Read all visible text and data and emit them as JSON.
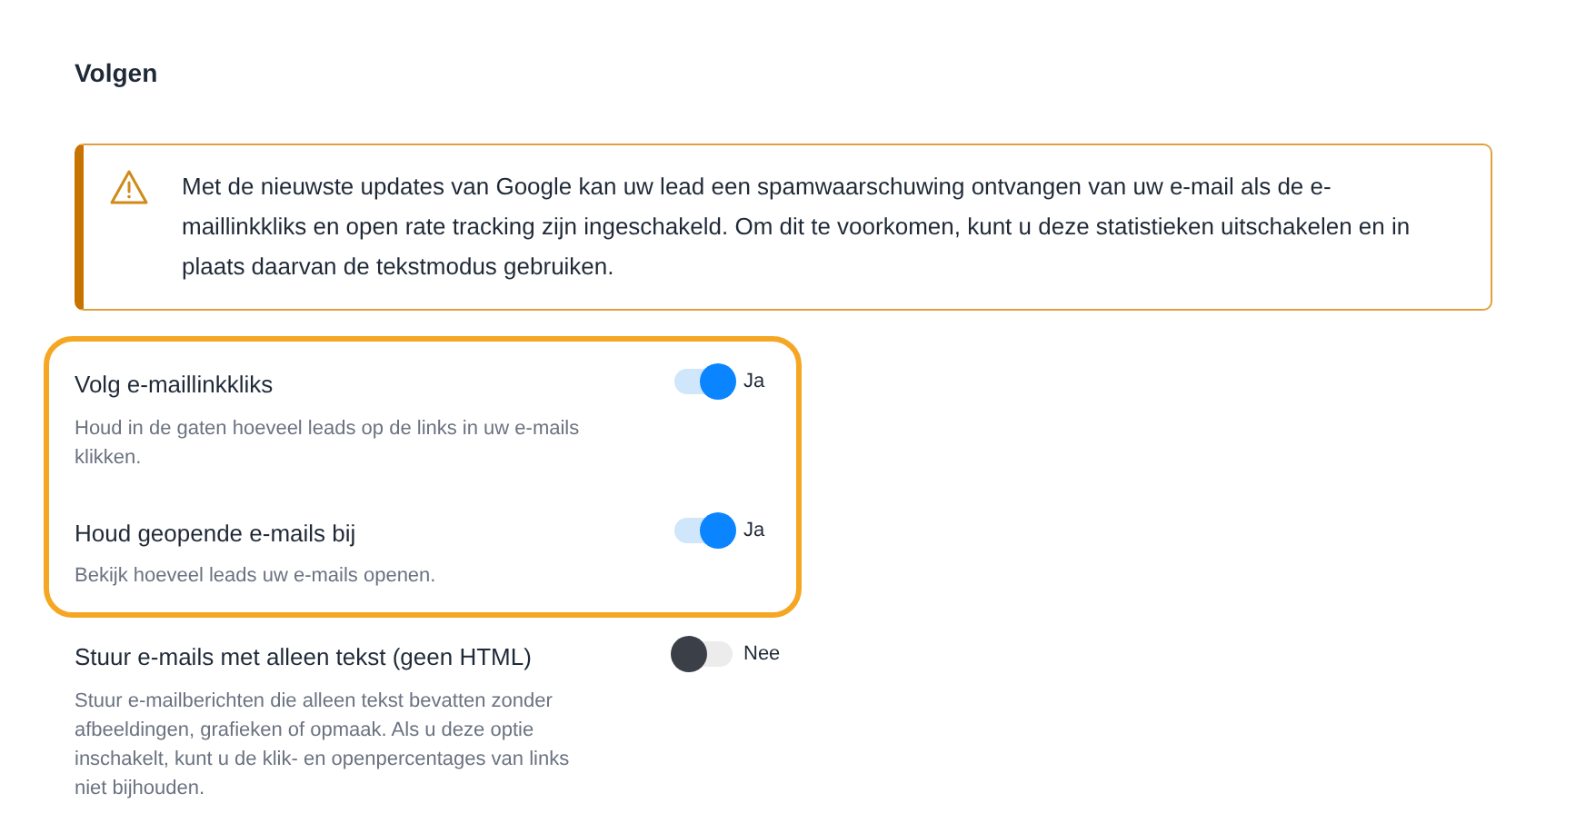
{
  "section": {
    "title": "Volgen"
  },
  "alert": {
    "text": "Met de nieuwste updates van Google kan uw lead een spamwaarschuwing ontvangen van uw e-mail als de e-maillinkkliks en open rate tracking zijn ingeschakeld. Om dit te voorkomen, kunt u deze statistieken uitschakelen en in plaats daarvan de tekstmodus gebruiken."
  },
  "settings": [
    {
      "title": "Volg e-maillinkkliks",
      "description": "Houd in de gaten hoeveel leads op de links in uw e-mails klikken.",
      "on": true,
      "state_label": "Ja",
      "highlighted": true
    },
    {
      "title": "Houd geopende e-mails bij",
      "description": "Bekijk hoeveel leads uw e-mails openen.",
      "on": true,
      "state_label": "Ja",
      "highlighted": true
    },
    {
      "title": "Stuur e-mails met alleen tekst (geen HTML)",
      "description": "Stuur e-mailberichten die alleen tekst bevatten zonder afbeeldingen, grafieken of opmaak. Als u deze optie inschakelt, kunt u de klik- en openpercentages van links niet bijhouden.",
      "on": false,
      "state_label": "Nee",
      "highlighted": false
    }
  ]
}
